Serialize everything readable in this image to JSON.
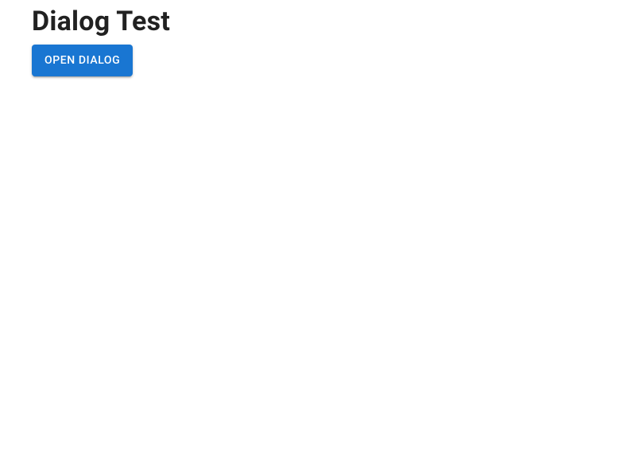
{
  "page": {
    "title": "Dialog Test"
  },
  "actions": {
    "open_dialog_label": "Open Dialog"
  },
  "colors": {
    "primary": "#1976d2",
    "text": "#212121"
  }
}
